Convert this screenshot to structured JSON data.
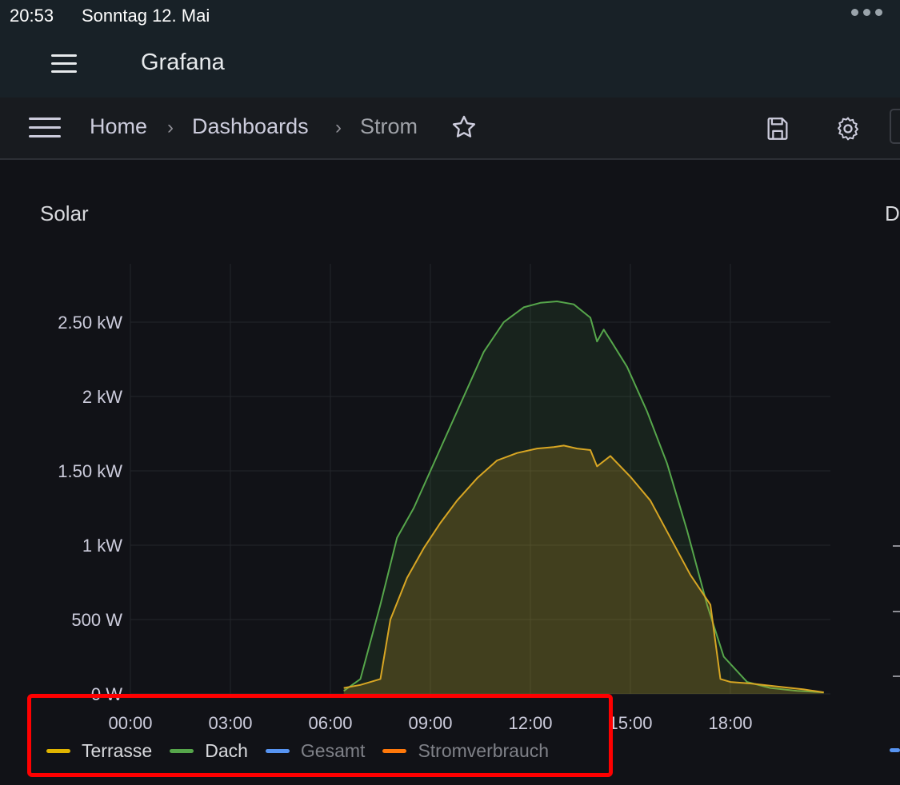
{
  "status_bar": {
    "time": "20:53",
    "date": "Sonntag 12. Mai"
  },
  "app": {
    "title": "Grafana"
  },
  "breadcrumb": {
    "home": "Home",
    "dashboards": "Dashboards",
    "current": "Strom",
    "separator": "›"
  },
  "panel": {
    "title": "Solar"
  },
  "panel2": {
    "title_partial": "D"
  },
  "legend": [
    {
      "label": "Terrasse",
      "color": "#e0b400",
      "dimmed": false
    },
    {
      "label": "Dach",
      "color": "#56a64b",
      "dimmed": false
    },
    {
      "label": "Gesamt",
      "color": "#5794f2",
      "dimmed": true
    },
    {
      "label": "Stromverbrauch",
      "color": "#ff780a",
      "dimmed": true
    }
  ],
  "chart_data": {
    "type": "area",
    "title": "Solar",
    "x_unit": "hour",
    "x_ticks": [
      "00:00",
      "03:00",
      "06:00",
      "09:00",
      "12:00",
      "15:00",
      "18:00"
    ],
    "y_ticks": [
      "0 W",
      "500 W",
      "1 kW",
      "1.50 kW",
      "2 kW",
      "2.50 kW"
    ],
    "ylim": [
      0,
      2.5
    ],
    "xlim": [
      0,
      21
    ],
    "grid": true,
    "legend_position": "bottom",
    "series": [
      {
        "name": "Terrasse",
        "color": "#d8a623",
        "x": [
          6.4,
          6.9,
          7.5,
          7.8,
          8.3,
          8.8,
          9.3,
          9.8,
          10.4,
          11.0,
          11.6,
          12.2,
          12.7,
          13.0,
          13.4,
          13.8,
          14.0,
          14.4,
          15.0,
          15.6,
          16.2,
          16.8,
          17.4,
          17.7,
          18.0,
          18.6,
          19.4,
          20.2,
          20.8
        ],
        "y": [
          0.04,
          0.06,
          0.1,
          0.5,
          0.78,
          0.98,
          1.15,
          1.3,
          1.45,
          1.57,
          1.62,
          1.65,
          1.66,
          1.67,
          1.65,
          1.64,
          1.53,
          1.6,
          1.46,
          1.3,
          1.05,
          0.8,
          0.6,
          0.1,
          0.08,
          0.07,
          0.05,
          0.03,
          0.01
        ]
      },
      {
        "name": "Dach",
        "color": "#56a64b",
        "x": [
          6.4,
          6.9,
          7.5,
          8.0,
          8.5,
          8.8,
          9.3,
          10.0,
          10.6,
          11.2,
          11.8,
          12.3,
          12.8,
          13.3,
          13.8,
          14.0,
          14.2,
          14.4,
          14.9,
          15.5,
          16.1,
          16.7,
          17.3,
          17.8,
          18.5,
          19.2,
          20.0,
          20.8
        ],
        "y": [
          0.02,
          0.1,
          0.6,
          1.05,
          1.25,
          1.4,
          1.65,
          2.0,
          2.3,
          2.5,
          2.6,
          2.63,
          2.64,
          2.62,
          2.53,
          2.37,
          2.45,
          2.38,
          2.2,
          1.9,
          1.55,
          1.1,
          0.6,
          0.25,
          0.08,
          0.04,
          0.02,
          0.01
        ]
      }
    ]
  }
}
